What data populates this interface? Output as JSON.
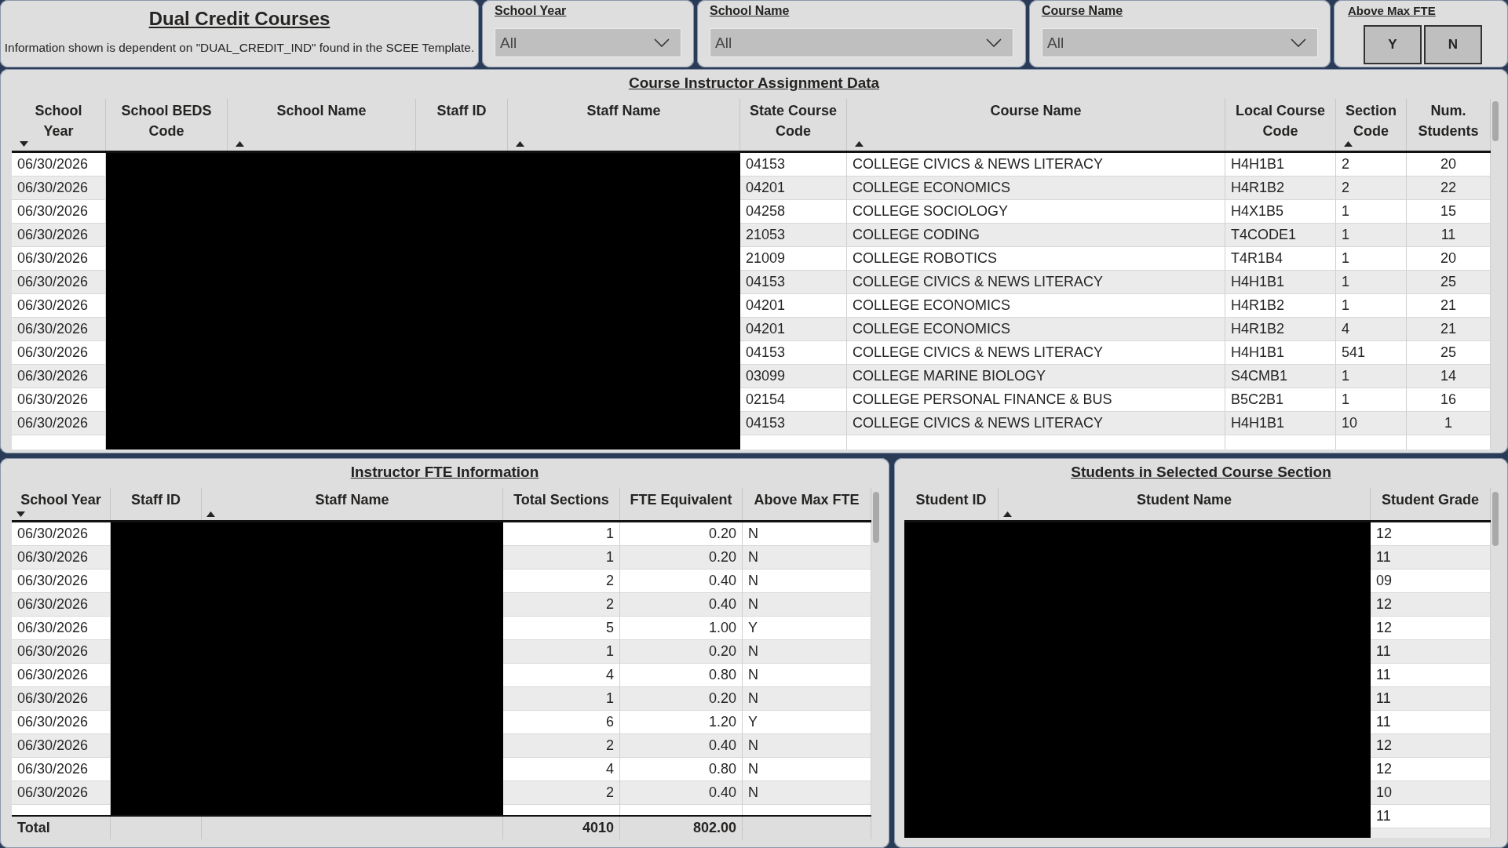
{
  "header": {
    "title": "Dual Credit Courses",
    "subtitle": "Information shown is dependent on \"DUAL_CREDIT_IND\" found in the SCEE Template."
  },
  "slicers": [
    {
      "label": "School Year",
      "value": "All"
    },
    {
      "label": "School Name",
      "value": "All"
    },
    {
      "label": "Course Name",
      "value": "All"
    }
  ],
  "fte_filter": {
    "label": "Above Max FTE",
    "buttons": [
      {
        "label": "Y",
        "selected": false
      },
      {
        "label": "N",
        "selected": false
      }
    ]
  },
  "assignment_table": {
    "title": "Course Instructor Assignment Data",
    "columns": [
      {
        "label": "School Year",
        "sorted": true,
        "descending": true,
        "redacted": false
      },
      {
        "label": "School BEDS Code",
        "sorted": false,
        "redacted": true
      },
      {
        "label": "School Name",
        "sorted": true,
        "descending": false,
        "redacted": true
      },
      {
        "label": "Staff ID",
        "sorted": false,
        "redacted": true
      },
      {
        "label": "Staff Name",
        "sorted": true,
        "descending": false,
        "redacted": true
      },
      {
        "label": "State Course Code",
        "sorted": false,
        "redacted": false
      },
      {
        "label": "Course Name",
        "sorted": true,
        "descending": false,
        "redacted": false
      },
      {
        "label": "Local Course Code",
        "sorted": false,
        "redacted": false
      },
      {
        "label": "Section Code",
        "sorted": true,
        "descending": false,
        "redacted": false
      },
      {
        "label": "Num. Students",
        "sorted": false,
        "redacted": false
      }
    ],
    "rows": [
      [
        "06/30/2026",
        "",
        "",
        "",
        "",
        "04153",
        "COLLEGE CIVICS & NEWS LITERACY",
        "H4H1B1",
        "2",
        "20"
      ],
      [
        "06/30/2026",
        "",
        "",
        "",
        "",
        "04201",
        "COLLEGE ECONOMICS",
        "H4R1B2",
        "2",
        "22"
      ],
      [
        "06/30/2026",
        "",
        "",
        "",
        "",
        "04258",
        "COLLEGE SOCIOLOGY",
        "H4X1B5",
        "1",
        "15"
      ],
      [
        "06/30/2026",
        "",
        "",
        "",
        "",
        "21053",
        "COLLEGE CODING",
        "T4CODE1",
        "1",
        "11"
      ],
      [
        "06/30/2026",
        "",
        "",
        "",
        "",
        "21009",
        "COLLEGE ROBOTICS",
        "T4R1B4",
        "1",
        "20"
      ],
      [
        "06/30/2026",
        "",
        "",
        "",
        "",
        "04153",
        "COLLEGE CIVICS & NEWS LITERACY",
        "H4H1B1",
        "1",
        "25"
      ],
      [
        "06/30/2026",
        "",
        "",
        "",
        "",
        "04201",
        "COLLEGE ECONOMICS",
        "H4R1B2",
        "1",
        "21"
      ],
      [
        "06/30/2026",
        "",
        "",
        "",
        "",
        "04201",
        "COLLEGE ECONOMICS",
        "H4R1B2",
        "4",
        "21"
      ],
      [
        "06/30/2026",
        "",
        "",
        "",
        "",
        "04153",
        "COLLEGE CIVICS & NEWS LITERACY",
        "H4H1B1",
        "541",
        "25"
      ],
      [
        "06/30/2026",
        "",
        "",
        "",
        "",
        "03099",
        "COLLEGE MARINE BIOLOGY",
        "S4CMB1",
        "1",
        "14"
      ],
      [
        "06/30/2026",
        "",
        "",
        "",
        "",
        "02154",
        "COLLEGE PERSONAL FINANCE & BUS",
        "B5C2B1",
        "1",
        "16"
      ],
      [
        "06/30/2026",
        "",
        "",
        "",
        "",
        "04153",
        "COLLEGE CIVICS & NEWS LITERACY",
        "H4H1B1",
        "10",
        "1"
      ]
    ]
  },
  "fte_table": {
    "title": "Instructor FTE Information",
    "columns": [
      {
        "label": "School Year",
        "sorted": true,
        "descending": true,
        "redacted": false
      },
      {
        "label": "Staff ID",
        "sorted": false,
        "redacted": true
      },
      {
        "label": "Staff Name",
        "sorted": true,
        "descending": false,
        "redacted": true
      },
      {
        "label": "Total Sections",
        "sorted": false,
        "redacted": false
      },
      {
        "label": "FTE Equivalent",
        "sorted": false,
        "redacted": false
      },
      {
        "label": "Above Max FTE",
        "sorted": false,
        "redacted": false
      }
    ],
    "rows": [
      [
        "06/30/2026",
        "",
        "",
        "1",
        "0.20",
        "N"
      ],
      [
        "06/30/2026",
        "",
        "",
        "1",
        "0.20",
        "N"
      ],
      [
        "06/30/2026",
        "",
        "",
        "2",
        "0.40",
        "N"
      ],
      [
        "06/30/2026",
        "",
        "",
        "2",
        "0.40",
        "N"
      ],
      [
        "06/30/2026",
        "",
        "",
        "5",
        "1.00",
        "Y"
      ],
      [
        "06/30/2026",
        "",
        "",
        "1",
        "0.20",
        "N"
      ],
      [
        "06/30/2026",
        "",
        "",
        "4",
        "0.80",
        "N"
      ],
      [
        "06/30/2026",
        "",
        "",
        "1",
        "0.20",
        "N"
      ],
      [
        "06/30/2026",
        "",
        "",
        "6",
        "1.20",
        "Y"
      ],
      [
        "06/30/2026",
        "",
        "",
        "2",
        "0.40",
        "N"
      ],
      [
        "06/30/2026",
        "",
        "",
        "4",
        "0.80",
        "N"
      ],
      [
        "06/30/2026",
        "",
        "",
        "2",
        "0.40",
        "N"
      ]
    ],
    "total": {
      "label": "Total",
      "total_sections": "4010",
      "fte_equivalent": "802.00"
    }
  },
  "students_table": {
    "title": "Students in Selected Course Section",
    "columns": [
      {
        "label": "Student ID",
        "sorted": false,
        "redacted": true
      },
      {
        "label": "Student Name",
        "sorted": true,
        "descending": false,
        "redacted": true
      },
      {
        "label": "Student Grade",
        "sorted": false,
        "redacted": false
      }
    ],
    "rows": [
      [
        "",
        "",
        "12"
      ],
      [
        "",
        "",
        "11"
      ],
      [
        "",
        "",
        "09"
      ],
      [
        "",
        "",
        "12"
      ],
      [
        "",
        "",
        "12"
      ],
      [
        "",
        "",
        "11"
      ],
      [
        "",
        "",
        "11"
      ],
      [
        "",
        "",
        "11"
      ],
      [
        "",
        "",
        "11"
      ],
      [
        "",
        "",
        "12"
      ],
      [
        "",
        "",
        "12"
      ],
      [
        "",
        "",
        "10"
      ],
      [
        "",
        "",
        "11"
      ]
    ]
  }
}
